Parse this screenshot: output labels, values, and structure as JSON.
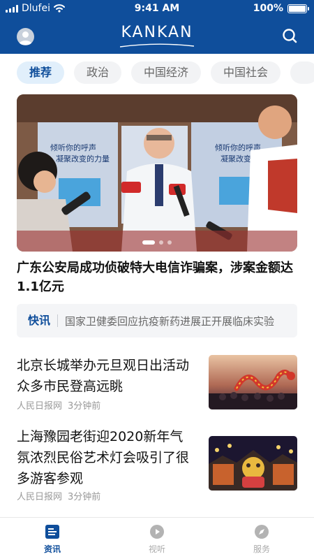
{
  "status_bar": {
    "carrier": "Dlufei",
    "time": "9:41 AM",
    "battery": "100%",
    "battery_level": 1.0
  },
  "app_bar": {
    "brand": "KANKAN",
    "icons": [
      "avatar",
      "search-icon"
    ]
  },
  "categories": [
    {
      "label": "推荐",
      "active": true
    },
    {
      "label": "政治",
      "active": false
    },
    {
      "label": "中国经济",
      "active": false
    },
    {
      "label": "中国社会",
      "active": false
    }
  ],
  "hero": {
    "banner_text_1": "倾听你的呼声",
    "banner_text_2": "凝聚改变的力量",
    "title": "广东公安局成功侦破特大电信诈骗案，涉案金额达1.1亿元",
    "carousel_index": 1,
    "carousel_count": 3
  },
  "flash": {
    "tag": "快讯",
    "text": "国家卫健委回应抗疫新药进展正开展临床实验"
  },
  "news": [
    {
      "title": "北京长城举办元旦观日出活动众多市民登高远眺",
      "source": "人民日报网",
      "time": "3分钟前"
    },
    {
      "title": "上海豫园老街迎2020新年气氛浓烈民俗艺术灯会吸引了很多游客参观",
      "source": "人民日报网",
      "time": "3分钟前"
    }
  ],
  "tabbar": [
    {
      "label": "资讯",
      "icon": "news-icon",
      "active": true
    },
    {
      "label": "视听",
      "icon": "play-icon",
      "active": false
    },
    {
      "label": "服务",
      "icon": "compass-icon",
      "active": false
    }
  ],
  "colors": {
    "primary": "#0f4e9b",
    "chip_active_bg": "#e1effb",
    "chip_bg": "#f2f3f5",
    "meta_text": "#999999"
  }
}
